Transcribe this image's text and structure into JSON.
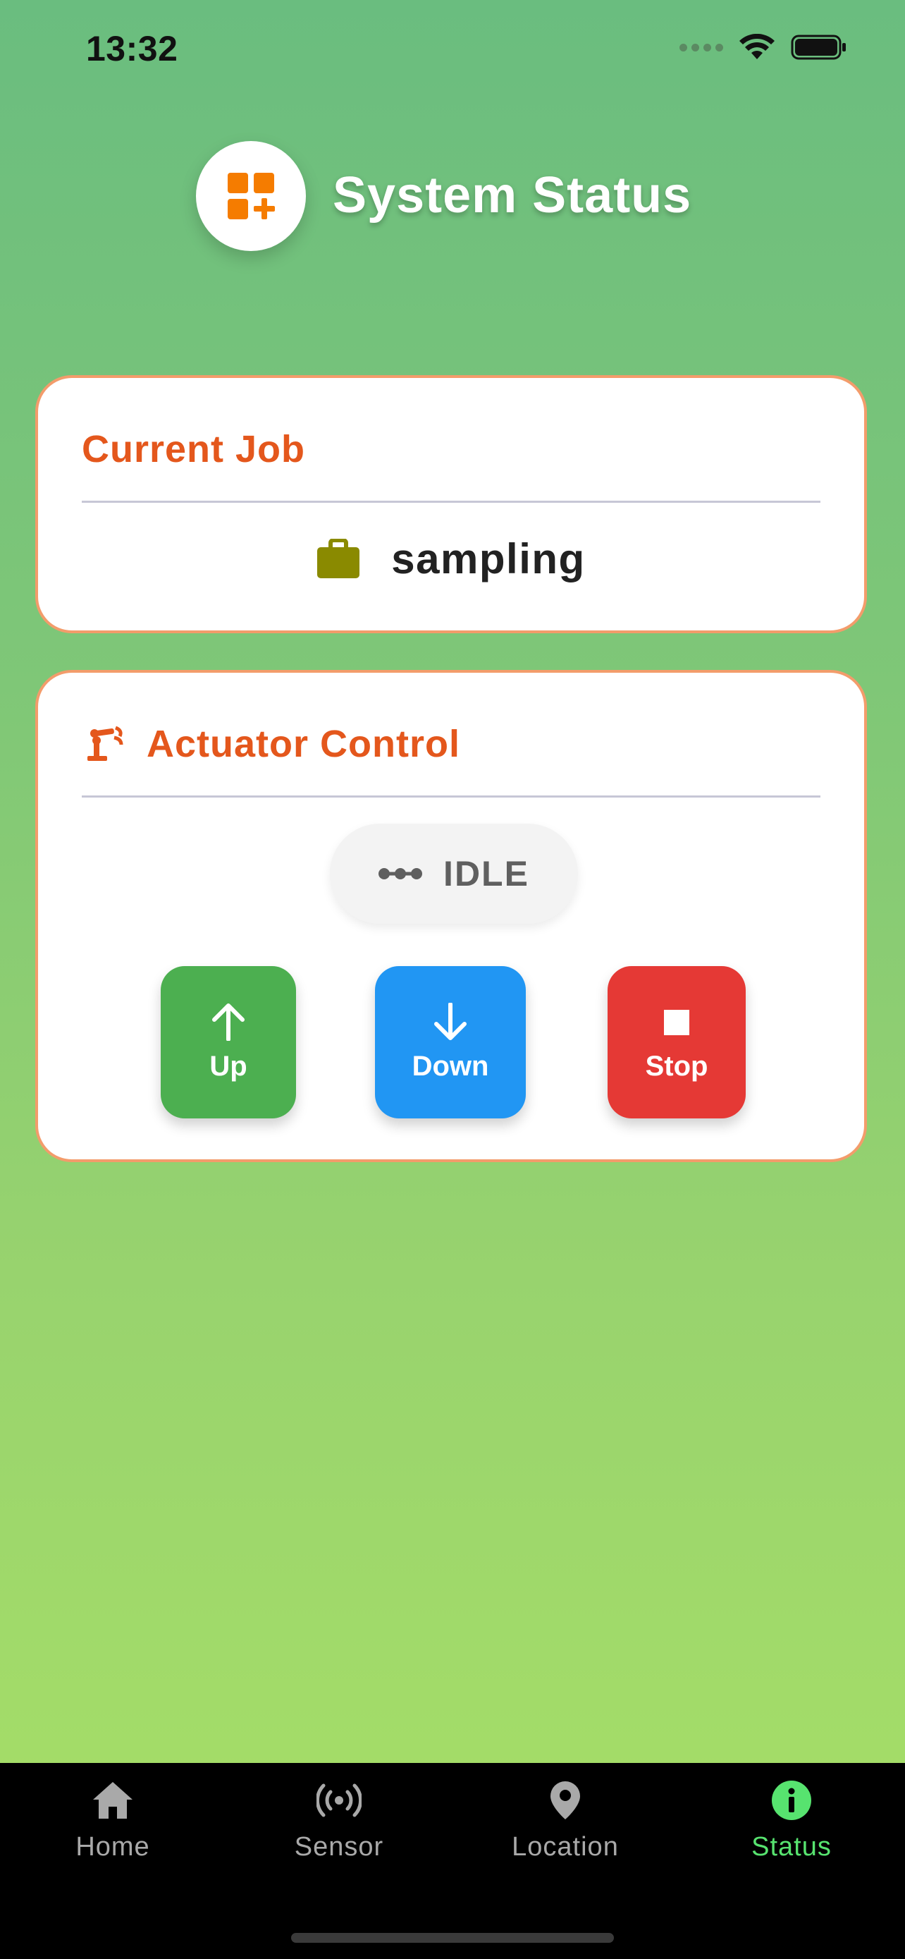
{
  "status_bar": {
    "time": "13:32"
  },
  "header": {
    "title": "System Status",
    "logo_icon": "dashboard-add-icon",
    "accent": "#f57c00"
  },
  "current_job": {
    "title": "Current Job",
    "value": "sampling",
    "icon": "briefcase-icon",
    "icon_color": "#8a8a00"
  },
  "actuator": {
    "title": "Actuator Control",
    "icon": "robot-arm-icon",
    "state": "IDLE",
    "buttons": [
      {
        "label": "Up",
        "icon": "arrow-up-icon",
        "color": "#4caf50"
      },
      {
        "label": "Down",
        "icon": "arrow-down-icon",
        "color": "#2196f3"
      },
      {
        "label": "Stop",
        "icon": "stop-icon",
        "color": "#e53935"
      }
    ]
  },
  "tabbar": {
    "items": [
      {
        "label": "Home",
        "icon": "home-icon"
      },
      {
        "label": "Sensor",
        "icon": "sensor-icon"
      },
      {
        "label": "Location",
        "icon": "location-pin-icon"
      },
      {
        "label": "Status",
        "icon": "info-icon",
        "active": true
      }
    ],
    "active_color": "#57e36f"
  }
}
